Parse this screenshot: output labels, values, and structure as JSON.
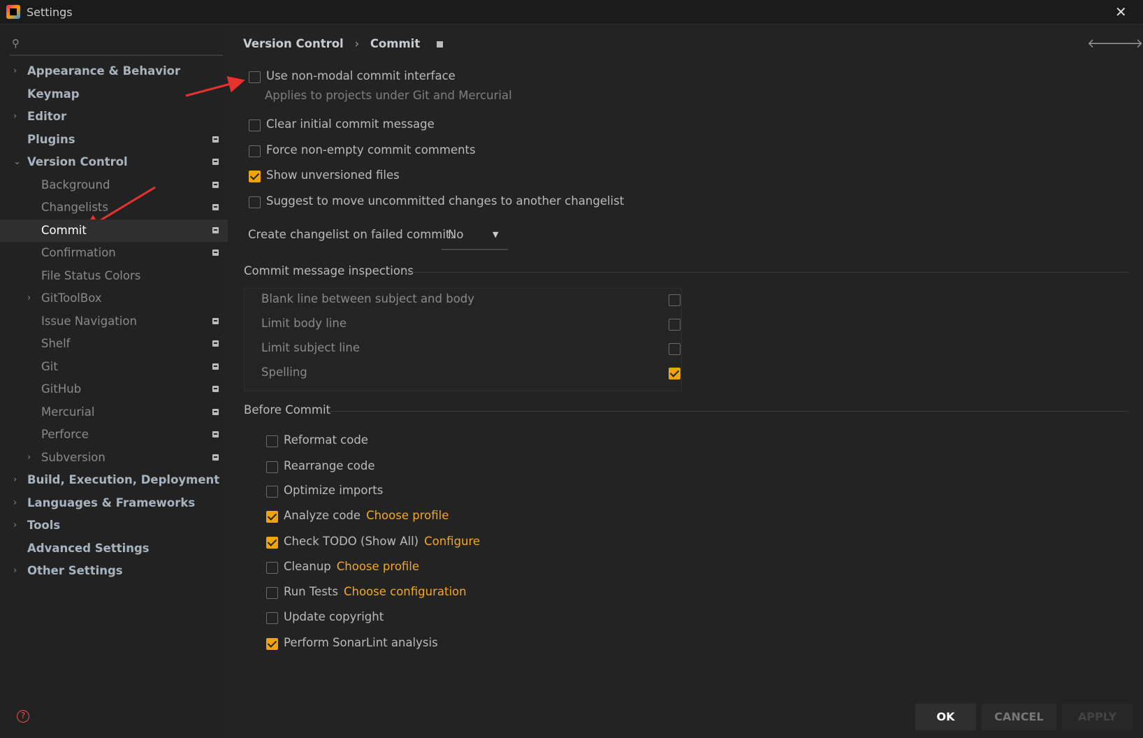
{
  "window": {
    "title": "Settings"
  },
  "sidebar": {
    "items": [
      {
        "label": "Appearance & Behavior",
        "level": 0,
        "chevron": "right",
        "lock": false
      },
      {
        "label": "Keymap",
        "level": 0,
        "chevron": "",
        "lock": false
      },
      {
        "label": "Editor",
        "level": 0,
        "chevron": "right",
        "lock": false
      },
      {
        "label": "Plugins",
        "level": 0,
        "chevron": "",
        "lock": true
      },
      {
        "label": "Version Control",
        "level": 0,
        "chevron": "down",
        "lock": true
      },
      {
        "label": "Background",
        "level": 1,
        "chevron": "",
        "lock": true
      },
      {
        "label": "Changelists",
        "level": 1,
        "chevron": "",
        "lock": true
      },
      {
        "label": "Commit",
        "level": 1,
        "chevron": "",
        "lock": true,
        "selected": true
      },
      {
        "label": "Confirmation",
        "level": 1,
        "chevron": "",
        "lock": true
      },
      {
        "label": "File Status Colors",
        "level": 1,
        "chevron": "",
        "lock": false
      },
      {
        "label": "GitToolBox",
        "level": 1,
        "chevron": "right",
        "lock": false
      },
      {
        "label": "Issue Navigation",
        "level": 1,
        "chevron": "",
        "lock": true
      },
      {
        "label": "Shelf",
        "level": 1,
        "chevron": "",
        "lock": true
      },
      {
        "label": "Git",
        "level": 1,
        "chevron": "",
        "lock": true
      },
      {
        "label": "GitHub",
        "level": 1,
        "chevron": "",
        "lock": true
      },
      {
        "label": "Mercurial",
        "level": 1,
        "chevron": "",
        "lock": true
      },
      {
        "label": "Perforce",
        "level": 1,
        "chevron": "",
        "lock": true
      },
      {
        "label": "Subversion",
        "level": 1,
        "chevron": "right",
        "lock": true
      },
      {
        "label": "Build, Execution, Deployment",
        "level": 0,
        "chevron": "right",
        "lock": false
      },
      {
        "label": "Languages & Frameworks",
        "level": 0,
        "chevron": "right",
        "lock": false
      },
      {
        "label": "Tools",
        "level": 0,
        "chevron": "right",
        "lock": false
      },
      {
        "label": "Advanced Settings",
        "level": 0,
        "chevron": "",
        "lock": false
      },
      {
        "label": "Other Settings",
        "level": 0,
        "chevron": "right",
        "lock": false
      }
    ]
  },
  "breadcrumb": {
    "parent": "Version Control",
    "sep": "›",
    "current": "Commit"
  },
  "options": [
    {
      "label": "Use non-modal commit interface",
      "checked": false
    },
    {
      "label": "Clear initial commit message",
      "checked": false
    },
    {
      "label": "Force non-empty commit comments",
      "checked": false
    },
    {
      "label": "Show unversioned files",
      "checked": true
    },
    {
      "label": "Suggest to move uncommitted changes to another changelist",
      "checked": false
    }
  ],
  "non_modal_hint": "Applies to projects under Git and Mercurial",
  "changelist_dropdown": {
    "label": "Create changelist on failed commit:",
    "value": "No"
  },
  "inspections": {
    "title": "Commit message inspections",
    "items": [
      {
        "label": "Blank line between subject and body",
        "checked": false
      },
      {
        "label": "Limit body line",
        "checked": false
      },
      {
        "label": "Limit subject line",
        "checked": false
      },
      {
        "label": "Spelling",
        "checked": true
      }
    ]
  },
  "before_commit": {
    "title": "Before Commit",
    "items": [
      {
        "label": "Reformat code",
        "checked": false,
        "link": ""
      },
      {
        "label": "Rearrange code",
        "checked": false,
        "link": ""
      },
      {
        "label": "Optimize imports",
        "checked": false,
        "link": ""
      },
      {
        "label": "Analyze code",
        "checked": true,
        "link": "Choose profile"
      },
      {
        "label": "Check TODO (Show All)",
        "checked": true,
        "link": "Configure"
      },
      {
        "label": "Cleanup",
        "checked": false,
        "link": "Choose profile"
      },
      {
        "label": "Run Tests",
        "checked": false,
        "link": "Choose configuration"
      },
      {
        "label": "Update copyright",
        "checked": false,
        "link": ""
      },
      {
        "label": "Perform SonarLint analysis",
        "checked": true,
        "link": ""
      }
    ]
  },
  "buttons": {
    "ok": "OK",
    "cancel": "CANCEL",
    "apply": "APPLY"
  },
  "colors": {
    "accent": "#f0a30a",
    "annotation_arrow": "#e8322f"
  }
}
